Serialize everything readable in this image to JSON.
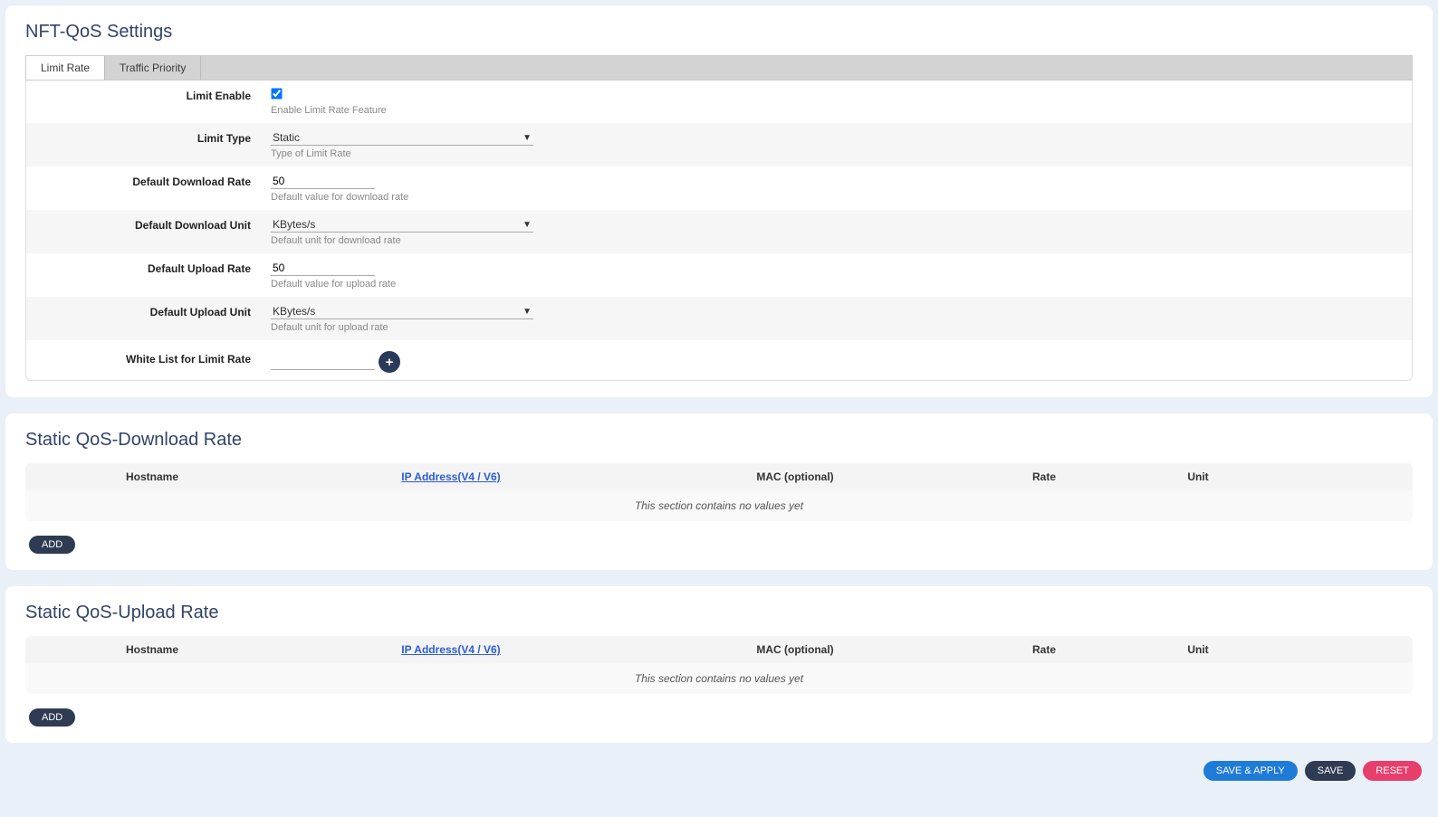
{
  "settings": {
    "title": "NFT-QoS Settings",
    "tabs": {
      "limit_rate": "Limit Rate",
      "traffic_priority": "Traffic Priority"
    },
    "rows": {
      "limit_enable": {
        "label": "Limit Enable",
        "help": "Enable Limit Rate Feature",
        "checked": true
      },
      "limit_type": {
        "label": "Limit Type",
        "value": "Static",
        "help": "Type of Limit Rate"
      },
      "dl_rate": {
        "label": "Default Download Rate",
        "value": "50",
        "help": "Default value for download rate"
      },
      "dl_unit": {
        "label": "Default Download Unit",
        "value": "KBytes/s",
        "help": "Default unit for download rate"
      },
      "ul_rate": {
        "label": "Default Upload Rate",
        "value": "50",
        "help": "Default value for upload rate"
      },
      "ul_unit": {
        "label": "Default Upload Unit",
        "value": "KBytes/s",
        "help": "Default unit for upload rate"
      },
      "whitelist": {
        "label": "White List for Limit Rate"
      }
    }
  },
  "download_table": {
    "title": "Static QoS-Download Rate",
    "headers": {
      "hostname": "Hostname",
      "ip": "IP Address(V4 / V6)",
      "mac": "MAC (optional)",
      "rate": "Rate",
      "unit": "Unit"
    },
    "empty": "This section contains no values yet",
    "add": "ADD"
  },
  "upload_table": {
    "title": "Static QoS-Upload Rate",
    "headers": {
      "hostname": "Hostname",
      "ip": "IP Address(V4 / V6)",
      "mac": "MAC (optional)",
      "rate": "Rate",
      "unit": "Unit"
    },
    "empty": "This section contains no values yet",
    "add": "ADD"
  },
  "footer": {
    "save_apply": "SAVE & APPLY",
    "save": "SAVE",
    "reset": "RESET"
  },
  "icons": {
    "plus": "+"
  }
}
